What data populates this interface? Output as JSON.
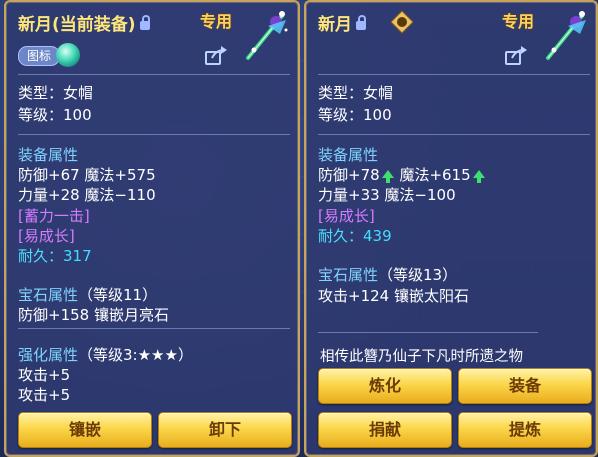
{
  "left": {
    "name": "新月",
    "tag": "(当前装备)",
    "special": "专用",
    "badge_label": "图标",
    "type_line": "类型：女帽",
    "level_line": "等级：100",
    "section_equip": "装备属性",
    "attr1": "防御+67 魔法+575",
    "attr2": "力量+28 魔法−110",
    "skill1": "[蓄力一击]",
    "skill2": "[易成长]",
    "durability_label": "耐久：",
    "durability_value": "317",
    "gem_title": "宝石属性",
    "gem_level": "（等级11）",
    "gem_attr": "防御+158 镶嵌月亮石",
    "enhance_title": "强化属性",
    "enhance_level": "（等级3:★★★）",
    "enhance1": "攻击+5",
    "enhance2": "攻击+5",
    "btn_inlay": "镶嵌",
    "btn_unequip": "卸下"
  },
  "right": {
    "name": "新月",
    "special": "专用",
    "type_line": "类型：女帽",
    "level_line": "等级：100",
    "section_equip": "装备属性",
    "attr1a": "防御+78",
    "attr1b": "魔法+615",
    "attr2": "力量+33 魔法−100",
    "skill1": "[易成长]",
    "durability_label": "耐久：",
    "durability_value": "439",
    "gem_title": "宝石属性",
    "gem_level": "（等级13）",
    "gem_attr": "攻击+124 镶嵌太阳石",
    "flavor": "相传此簪乃仙子下凡时所遗之物",
    "btn_refine": "炼化",
    "btn_equip": "装备",
    "btn_donate": "捐献",
    "btn_extract": "提炼"
  }
}
